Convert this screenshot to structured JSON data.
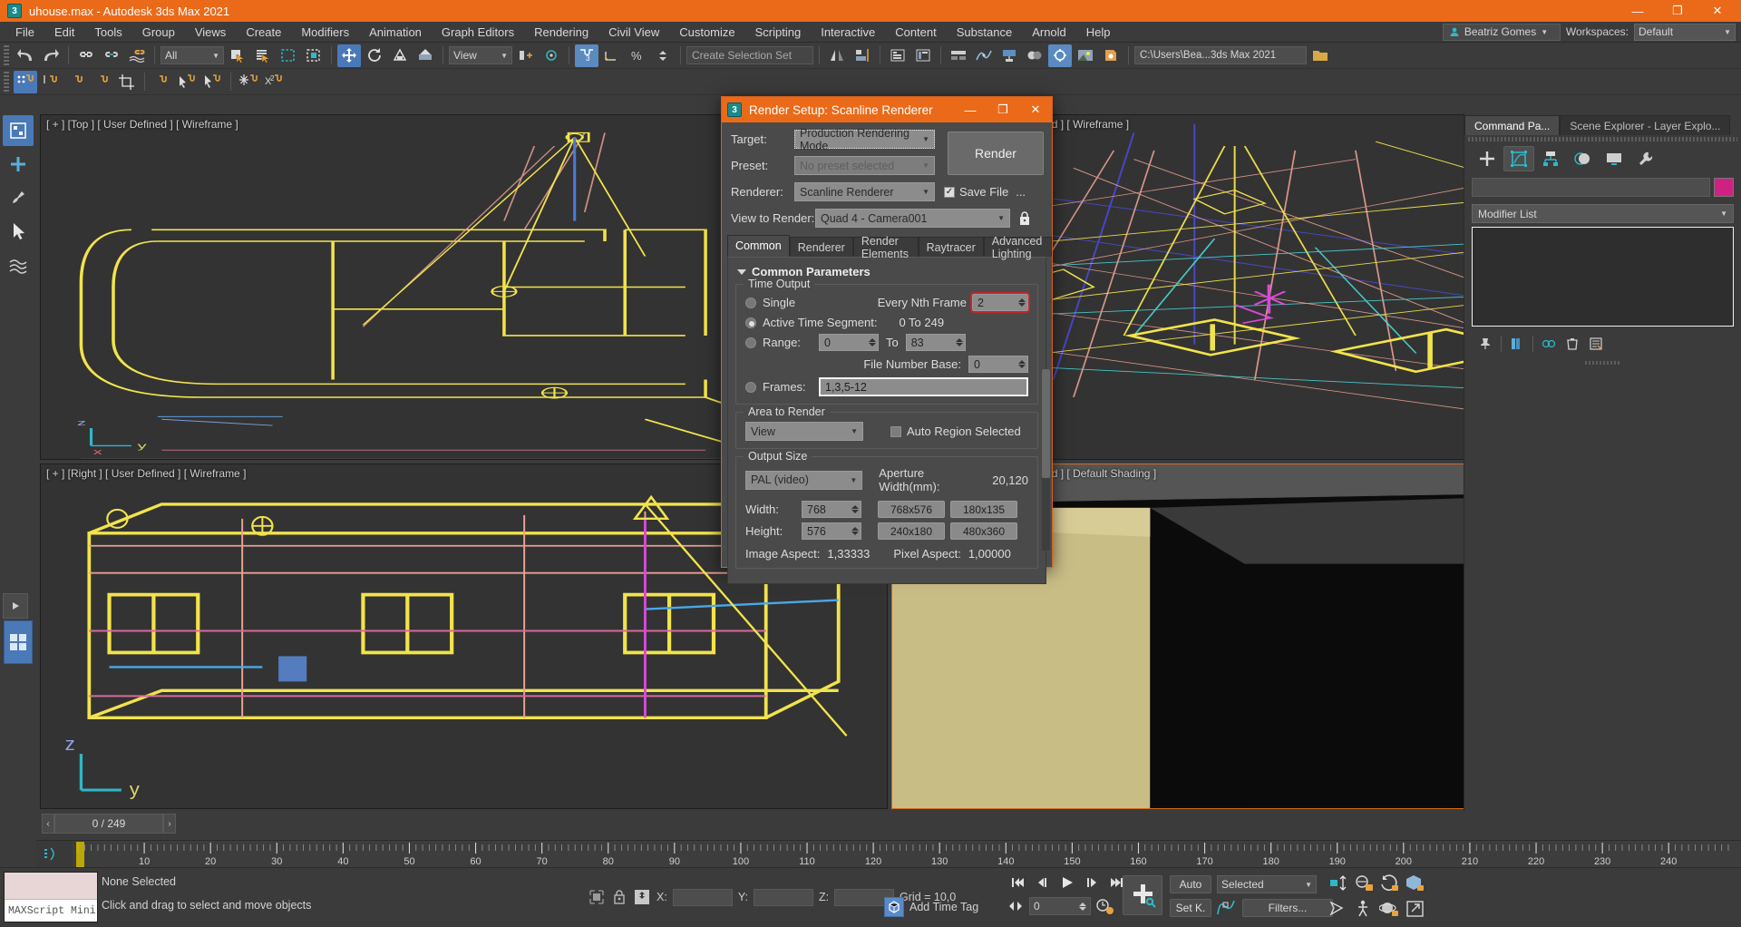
{
  "window": {
    "title": "uhouse.max - Autodesk 3ds Max 2021",
    "minimize": "—",
    "maximize": "❐",
    "close": "✕",
    "app_icon": "3"
  },
  "menubar": {
    "items": [
      "File",
      "Edit",
      "Tools",
      "Group",
      "Views",
      "Create",
      "Modifiers",
      "Animation",
      "Graph Editors",
      "Rendering",
      "Civil View",
      "Customize",
      "Scripting",
      "Interactive",
      "Content",
      "Substance",
      "Arnold",
      "Help"
    ],
    "user": "Beatriz Gomes",
    "workspaces_label": "Workspaces:",
    "workspace_value": "Default"
  },
  "toolbar": {
    "selection_filter": "All",
    "selection_set_placeholder": "Create Selection Set",
    "coord_system": "View",
    "project_path": "C:\\Users\\Bea...3ds Max 2021"
  },
  "viewports": [
    {
      "label": "[ + ] [Top ] [ User Defined ] [ Wireframe ]"
    },
    {
      "label": "[ + ] [Perspective ] [ User Defined ] [ Wireframe ]"
    },
    {
      "label": "[ + ] [Right ] [ User Defined ] [ Wireframe ]"
    },
    {
      "label": "[ + ] [Camera001 ] [ User Defined ] [ Default Shading ]"
    }
  ],
  "command_panel": {
    "tabs": [
      "Command Pa...",
      "Scene Explorer - Layer Explo..."
    ],
    "active_tab": "Command Pa...",
    "object_name": "",
    "object_color": "#cf2184",
    "modifier_list": "Modifier List"
  },
  "timeline": {
    "frame_display": "0 / 249",
    "prev_arrow": "‹",
    "next_arrow": "›",
    "ticks": [
      10,
      20,
      30,
      40,
      50,
      60,
      70,
      80,
      90,
      100,
      110,
      120,
      130,
      140,
      150,
      160,
      170,
      180,
      190,
      200,
      210,
      220,
      230,
      240
    ]
  },
  "statusbar": {
    "maxscript_label": "MAXScript Mini",
    "selection_status": "None Selected",
    "prompt": "Click and drag to select and move objects",
    "x_label": "X:",
    "y_label": "Y:",
    "z_label": "Z:",
    "x_value": "",
    "y_value": "",
    "z_value": "",
    "grid": "Grid = 10,0",
    "add_time_tag": "Add Time Tag",
    "auto_key": "Auto",
    "set_key": "Set K.",
    "key_filters": "Filters...",
    "key_mode": "Selected",
    "current_frame": "0"
  },
  "render_setup": {
    "title": "Render Setup: Scanline Renderer",
    "icon": "3",
    "minimize": "—",
    "maximize": "❐",
    "close": "✕",
    "target_label": "Target:",
    "target_value": "Production Rendering Mode",
    "preset_label": "Preset:",
    "preset_value": "No preset selected",
    "renderer_label": "Renderer:",
    "renderer_value": "Scanline Renderer",
    "save_file_label": "Save File",
    "save_file_ellipsis": "...",
    "save_file_checked": "✓",
    "view_to_render_label": "View to Render:",
    "view_to_render_value": "Quad 4 - Camera001",
    "render_button": "Render",
    "tabs": [
      "Common",
      "Renderer",
      "Render Elements",
      "Raytracer",
      "Advanced Lighting"
    ],
    "active_tab": "Common",
    "rollout_title": "Common Parameters",
    "time_output": {
      "legend": "Time Output",
      "single": "Single",
      "every_nth_frame_label": "Every Nth Frame",
      "every_nth_frame_value": "2",
      "active_time_segment": "Active Time Segment:",
      "active_time_segment_range": "0 To 249",
      "range": "Range:",
      "range_from": "0",
      "range_to_label": "To",
      "range_to": "83",
      "file_number_base_label": "File Number Base:",
      "file_number_base": "0",
      "frames": "Frames:",
      "frames_value": "1,3,5-12",
      "selected": "active_time_segment"
    },
    "area_to_render": {
      "legend": "Area to Render",
      "value": "View",
      "auto_region_label": "Auto Region Selected",
      "auto_region_checked": false
    },
    "output_size": {
      "legend": "Output Size",
      "preset": "PAL (video)",
      "aperture_label": "Aperture Width(mm):",
      "aperture_value": "20,120",
      "width_label": "Width:",
      "width_value": "768",
      "height_label": "Height:",
      "height_value": "576",
      "presets": [
        "768x576",
        "180x135",
        "240x180",
        "480x360"
      ],
      "image_aspect_label": "Image Aspect:",
      "image_aspect_value": "1,33333",
      "pixel_aspect_label": "Pixel Aspect:",
      "pixel_aspect_value": "1,00000"
    }
  },
  "colors": {
    "accent": "#ea6a19",
    "panel": "#4a4a4a",
    "viewport": "#333333",
    "highlight": "#c1272d",
    "wire_yellow": "#f2e34c",
    "blue_button": "#4a79b8"
  }
}
